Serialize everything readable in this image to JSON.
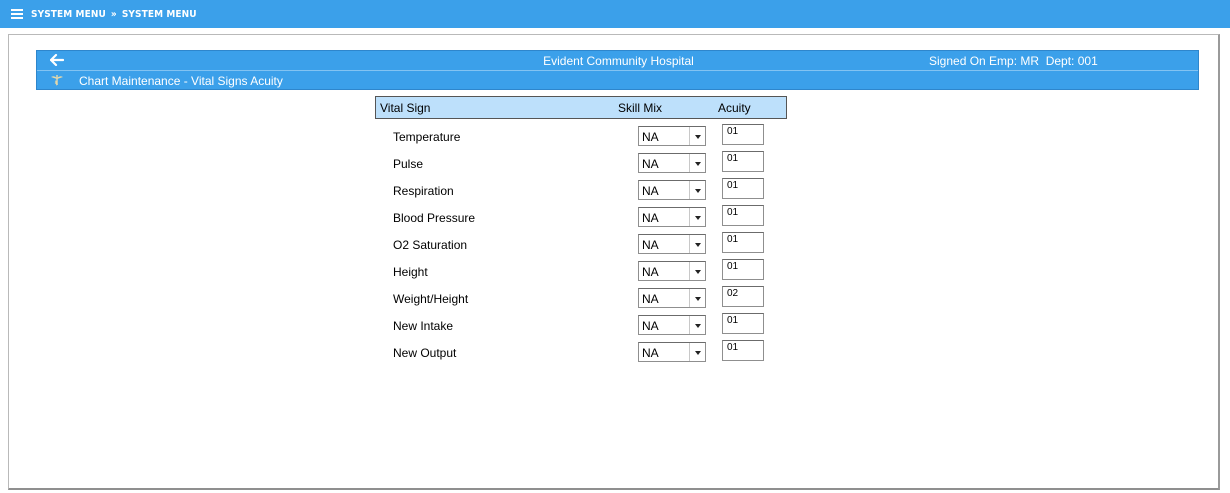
{
  "topbar": {
    "menu_icon": "hamburger-menu-icon",
    "crumb1": "SYSTEM MENU",
    "separator": "»",
    "crumb2": "SYSTEM MENU"
  },
  "header": {
    "back_icon": "back-arrow-icon",
    "hospital": "Evident Community Hospital",
    "signed_on": "Signed On Emp: MR  Dept: 001",
    "module_icon": "caduceus-icon",
    "page_title": "Chart Maintenance - Vital Signs Acuity"
  },
  "table": {
    "col_vital": "Vital Sign",
    "col_skill": "Skill Mix",
    "col_acuity": "Acuity",
    "rows": [
      {
        "label": "Temperature",
        "skill": "NA",
        "acuity": "01"
      },
      {
        "label": "Pulse",
        "skill": "NA",
        "acuity": "01"
      },
      {
        "label": "Respiration",
        "skill": "NA",
        "acuity": "01"
      },
      {
        "label": "Blood Pressure",
        "skill": "NA",
        "acuity": "01"
      },
      {
        "label": "O2 Saturation",
        "skill": "NA",
        "acuity": "01"
      },
      {
        "label": "Height",
        "skill": "NA",
        "acuity": "01"
      },
      {
        "label": "Weight/Height",
        "skill": "NA",
        "acuity": "02"
      },
      {
        "label": "New Intake",
        "skill": "NA",
        "acuity": "01"
      },
      {
        "label": "New Output",
        "skill": "NA",
        "acuity": "01"
      }
    ]
  },
  "colors": {
    "accent_blue": "#3ba0ea",
    "table_header_bg": "#bde0fb"
  }
}
